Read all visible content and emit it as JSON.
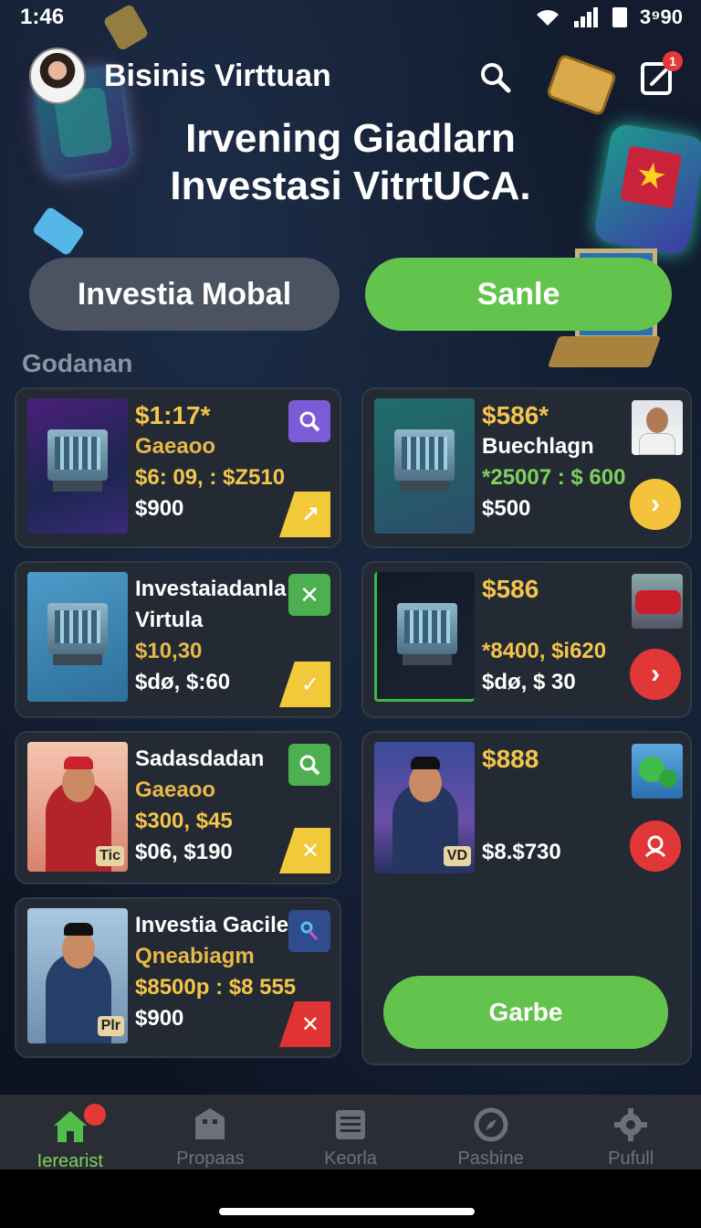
{
  "status_bar": {
    "time": "1:46",
    "battery_text": "3⁹90"
  },
  "header": {
    "app_title": "Bisinis Virttuan",
    "notification_count": "1"
  },
  "hero": {
    "line1": "Irvening Giadlarn",
    "line2": "Investasi VitrtUCA."
  },
  "actions": {
    "left_label": "Investia Mobal",
    "right_label": "Sanle"
  },
  "section_title": "Godanan",
  "cards": [
    {
      "line1": "$1:17*",
      "line2": "Gaeaoo",
      "line3": "$6: 09, : $Z510",
      "line4": "$900"
    },
    {
      "line1": "$586*",
      "line2": "Buechlagn",
      "line3": "*25007 : $ 600",
      "line4": "$500"
    },
    {
      "line1": "Investaiadanla",
      "line2": "Virtula",
      "line3": "$10,30",
      "line4": "$dø, $:60"
    },
    {
      "line1": "$586",
      "line3": "*8400, $i620",
      "line4": "$dø, $ 30"
    },
    {
      "line1": "Sadasdadan",
      "line2": "Gaeaoo",
      "line3": "$300, $45",
      "line4": "$06, $190",
      "badge": "Tic"
    },
    {
      "line1": "$888",
      "line4": "$8.$730",
      "badge": "VD"
    },
    {
      "line1": "Investia Gacile",
      "line2": "Qneabiagm",
      "line3": "$8500p : $8 555",
      "line4": "$900",
      "badge": "Plr"
    }
  ],
  "garbe_button": "Garbe",
  "nav": [
    {
      "label": "Ierearist"
    },
    {
      "label": "Propaas"
    },
    {
      "label": "Keorla"
    },
    {
      "label": "Pasbine"
    },
    {
      "label": "Pufull"
    }
  ],
  "colors": {
    "accent_green": "#62c44c",
    "price_yellow": "#f3c54a",
    "danger_red": "#e23737"
  }
}
